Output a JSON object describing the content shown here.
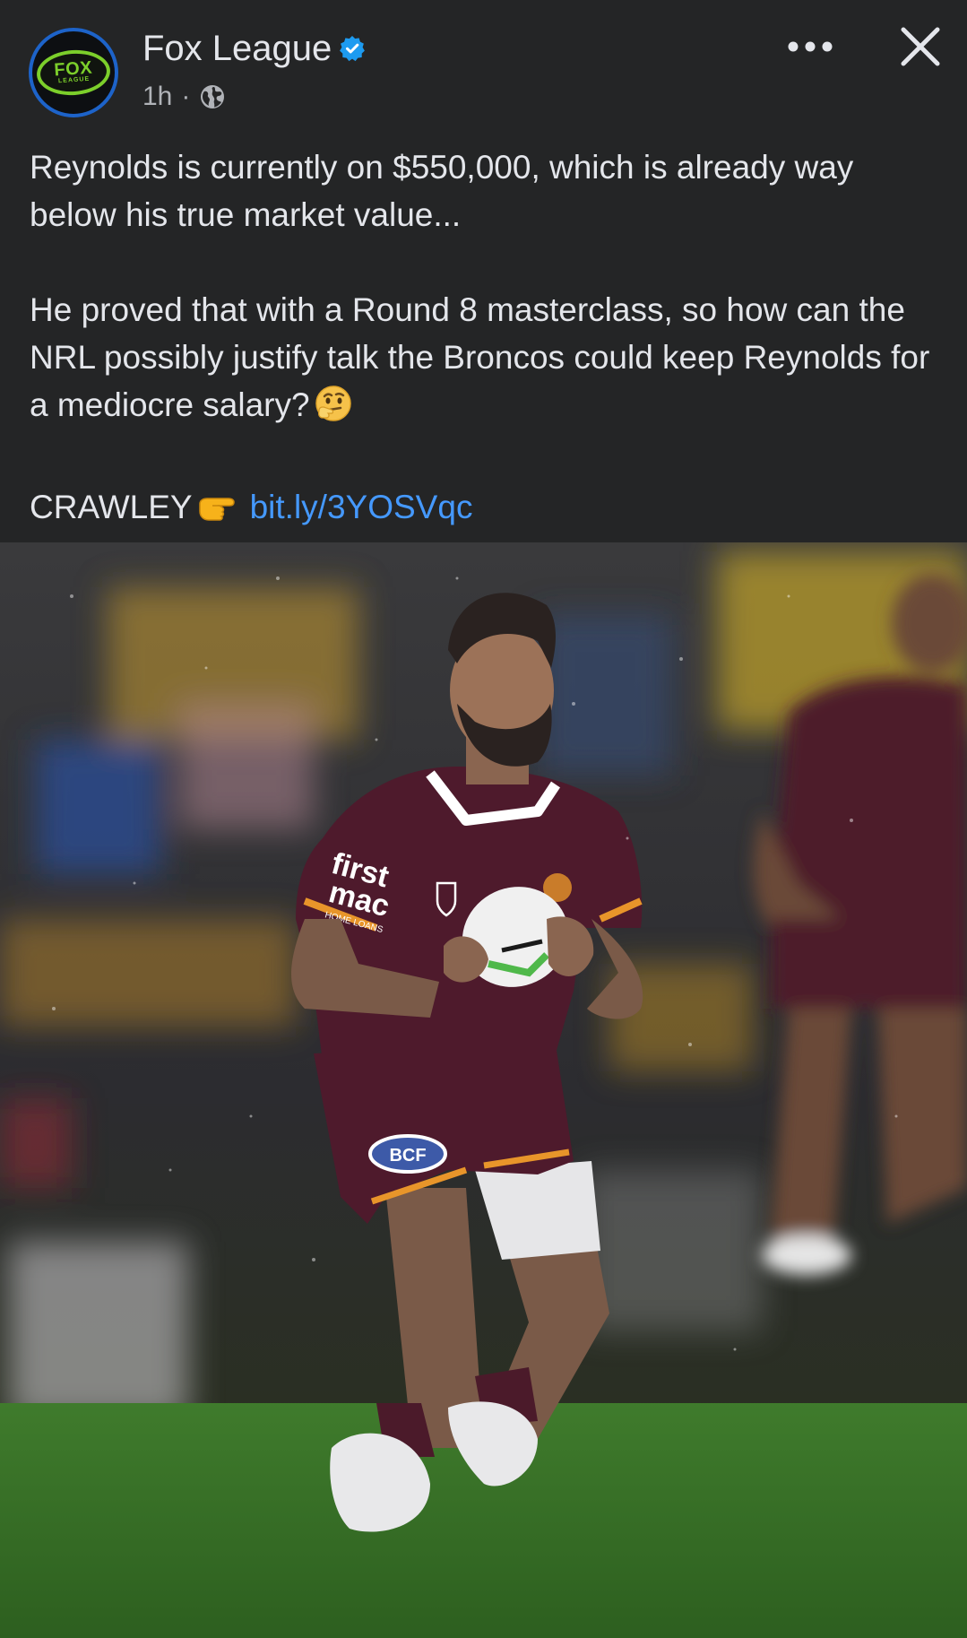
{
  "post": {
    "page_name": "Fox League",
    "time": "1h",
    "separator": "·",
    "avatar": {
      "logo_main": "FOX",
      "logo_sub": "LEAGUE"
    },
    "icons": {
      "verified": "verified-badge-icon",
      "audience": "globe-icon",
      "more": "more-options-icon",
      "close": "close-icon"
    },
    "colors": {
      "background": "#242526",
      "text": "#e4e6eb",
      "muted": "#b0b3b8",
      "link": "#4599ff",
      "verified": "#1d9bf0",
      "avatar_ring": "#1d63c9",
      "logo_green": "#7ccf2b"
    },
    "text": {
      "para1": "Reynolds is currently on $550,000, which is already way below his true market value...",
      "para2": "He proved that with a Round 8 masterclass, so how can the NRL possibly justify talk the Broncos could keep Reynolds for a mediocre salary?",
      "para2_emoji": "thinking-face-emoji",
      "para3_prefix": "CRAWLEY",
      "para3_emoji": "pointing-right-emoji",
      "link": "bit.ly/3YOSVqc"
    },
    "photo": {
      "jersey_text_1": "first",
      "jersey_text_2": "mac",
      "jersey_text_3": "HOME LOANS",
      "shorts_sponsor": "BCF"
    }
  }
}
